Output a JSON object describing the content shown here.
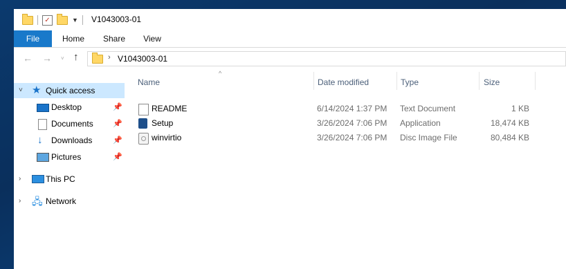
{
  "window": {
    "title": "V1043003-01"
  },
  "ribbon": {
    "tabs": [
      "File",
      "Home",
      "Share",
      "View"
    ]
  },
  "navigation": {
    "back_symbol": "←",
    "forward_symbol": "→",
    "recent_symbol": "˅",
    "up_symbol": "↑"
  },
  "address_bar": {
    "separator": "›",
    "path": "V1043003-01"
  },
  "nav_pane": {
    "quick_access": {
      "label": "Quick access",
      "icon": "star-icon"
    },
    "pinned": [
      {
        "label": "Desktop",
        "icon": "desktop-icon"
      },
      {
        "label": "Documents",
        "icon": "documents-icon"
      },
      {
        "label": "Downloads",
        "icon": "downloads-icon"
      },
      {
        "label": "Pictures",
        "icon": "pictures-icon"
      }
    ],
    "this_pc": {
      "label": "This PC",
      "icon": "computer-icon"
    },
    "network": {
      "label": "Network",
      "icon": "network-icon"
    }
  },
  "file_list": {
    "columns": [
      "Name",
      "Date modified",
      "Type",
      "Size"
    ],
    "sort_column": "Name",
    "rows": [
      {
        "name": "README",
        "date": "6/14/2024 1:37 PM",
        "type": "Text Document",
        "size": "1 KB",
        "icon": "text-file-icon"
      },
      {
        "name": "Setup",
        "date": "3/26/2024 7:06 PM",
        "type": "Application",
        "size": "18,474 KB",
        "icon": "setup-app-icon"
      },
      {
        "name": "winvirtio",
        "date": "3/26/2024 7:06 PM",
        "type": "Disc Image File",
        "size": "80,484 KB",
        "icon": "disc-image-icon"
      }
    ]
  },
  "colors": {
    "accent": "#1979ca",
    "selection": "#cce8ff",
    "desktop_background": "#0b3a6e"
  }
}
